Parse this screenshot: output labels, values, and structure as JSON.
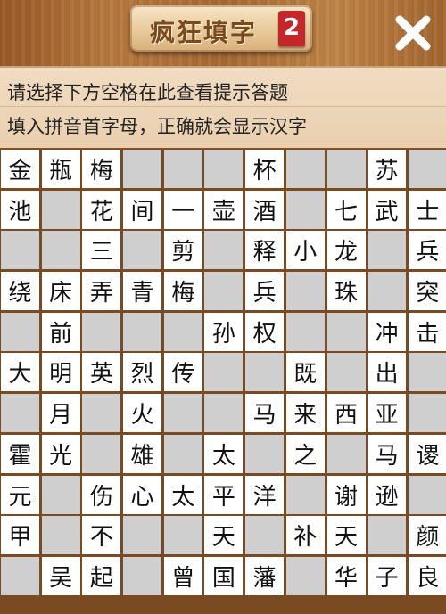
{
  "header": {
    "title": "疯狂填字",
    "badge": "2",
    "close_icon": "close-x-icon"
  },
  "hints": {
    "line1": "请选择下方空格在此查看提示答题",
    "line2": "填入拼音首字母，正确就会显示汉字"
  },
  "colors": {
    "wood": "#a86a33",
    "badge": "#c4262a",
    "cell_filled": "#ffffff",
    "cell_empty": "#cfcfcf"
  },
  "grid": {
    "rows": [
      [
        "金",
        "瓶",
        "梅",
        "",
        "",
        "",
        "杯",
        "",
        "",
        "苏",
        ""
      ],
      [
        "池",
        "",
        "花",
        "间",
        "一",
        "壶",
        "酒",
        "",
        "七",
        "武",
        "士"
      ],
      [
        "",
        "",
        "三",
        "",
        "剪",
        "",
        "释",
        "小",
        "龙",
        "",
        "兵"
      ],
      [
        "绕",
        "床",
        "弄",
        "青",
        "梅",
        "",
        "兵",
        "",
        "珠",
        "",
        "突"
      ],
      [
        "",
        "前",
        "",
        "",
        "",
        "孙",
        "权",
        "",
        "",
        "冲",
        "击"
      ],
      [
        "大",
        "明",
        "英",
        "烈",
        "传",
        "",
        "",
        "既",
        "",
        "出",
        ""
      ],
      [
        "",
        "月",
        "",
        "火",
        "",
        "",
        "马",
        "来",
        "西",
        "亚",
        ""
      ],
      [
        "霍",
        "光",
        "",
        "雄",
        "",
        "太",
        "",
        "之",
        "",
        "马",
        "谡"
      ],
      [
        "元",
        "",
        "伤",
        "心",
        "太",
        "平",
        "洋",
        "",
        "谢",
        "逊",
        ""
      ],
      [
        "甲",
        "",
        "不",
        "",
        "",
        "天",
        "",
        "补",
        "天",
        "",
        "颜"
      ],
      [
        "",
        "吴",
        "起",
        "",
        "曾",
        "国",
        "藩",
        "",
        "华",
        "子",
        "良"
      ]
    ]
  }
}
